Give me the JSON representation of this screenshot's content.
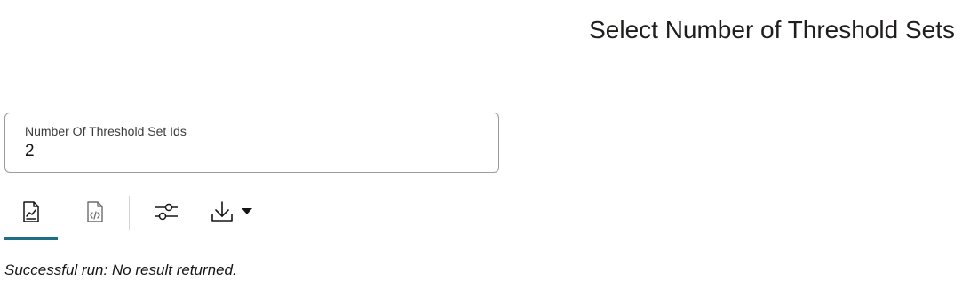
{
  "header": {
    "title": "Select Number of Threshold Sets"
  },
  "form": {
    "field_label": "Number Of Threshold Set Ids",
    "field_value": "2"
  },
  "toolbar": {
    "buttons": [
      {
        "icon": "chart-report-icon",
        "active": true
      },
      {
        "icon": "code-file-icon",
        "active": false
      },
      {
        "icon": "sliders-icon",
        "active": false
      },
      {
        "icon": "download-icon",
        "active": false
      },
      {
        "icon": "caret-down-icon",
        "active": false
      }
    ],
    "accent_color": "#1d6f85"
  },
  "result": {
    "status_text": "Successful run: No result returned."
  }
}
